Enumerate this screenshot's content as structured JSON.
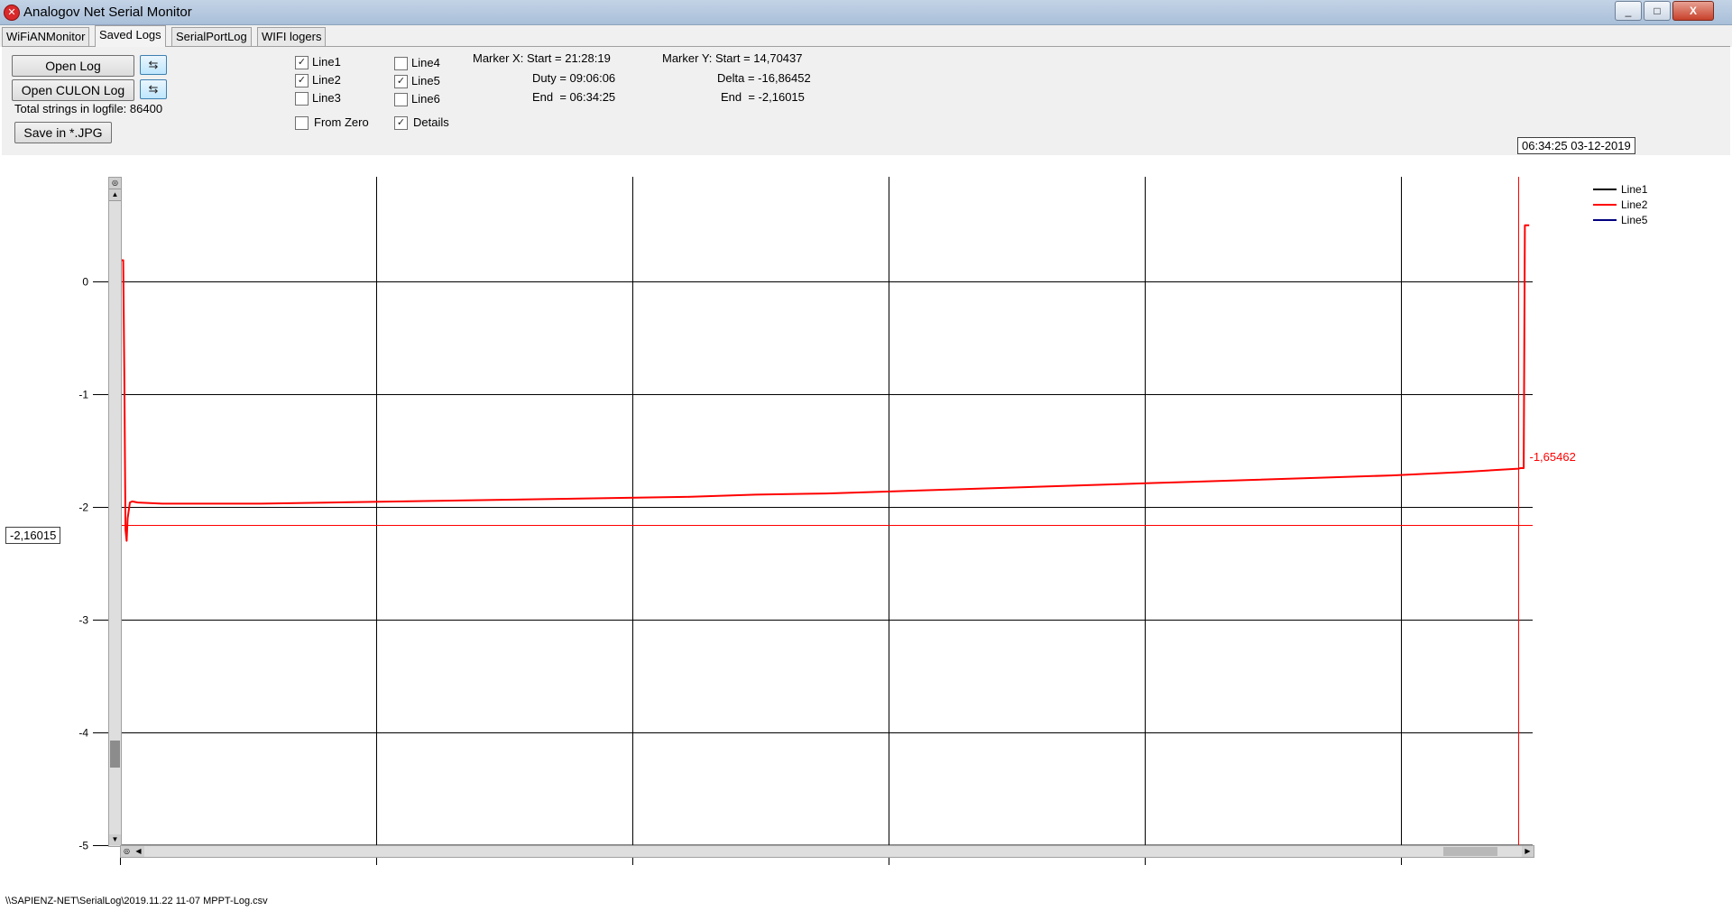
{
  "window": {
    "title": "Analogov Net Serial Monitor",
    "icon": "app-close-circle-icon",
    "minimize_glyph": "_",
    "maximize_glyph": "□",
    "close_glyph": "X"
  },
  "tabs": [
    {
      "label": "WiFiANMonitor",
      "active": false
    },
    {
      "label": "Saved Logs",
      "active": true
    },
    {
      "label": "SerialPortLog",
      "active": false
    },
    {
      "label": "WIFI logers",
      "active": false
    }
  ],
  "controls": {
    "open_log": "Open Log",
    "open_culon_log": "Open CULON Log",
    "refresh_glyph": "⇆",
    "total_strings": "Total strings in logfile: 86400",
    "save_jpg": "Save in *.JPG"
  },
  "checkboxes": [
    {
      "label": "Line1",
      "checked": true
    },
    {
      "label": "Line2",
      "checked": true
    },
    {
      "label": "Line3",
      "checked": false
    },
    {
      "label": "Line4",
      "checked": false
    },
    {
      "label": "Line5",
      "checked": true
    },
    {
      "label": "Line6",
      "checked": false
    },
    {
      "label": "From Zero",
      "checked": false
    },
    {
      "label": "Details",
      "checked": true
    }
  ],
  "marker_x": {
    "start": "Marker X: Start = 21:28:19",
    "duty": "Duty = 09:06:06",
    "end": "End  = 06:34:25"
  },
  "marker_y": {
    "start": "Marker Y: Start = 14,70437",
    "delta": "Delta = -16,86452",
    "end": "End  = -2,16015"
  },
  "cursor_datetime": "06:34:25 03-12-2019",
  "cursor_y_value": "-2,16015",
  "status_path": "\\\\SAPIENZ-NET\\SerialLog\\2019.11.22 11-07 MPPT-Log.csv",
  "chart_data": {
    "type": "line",
    "ylim": [
      -5,
      0.93
    ],
    "yticks": [
      0,
      -1,
      -2,
      -3,
      -4,
      -5
    ],
    "ytick_labels": [
      "0",
      "-1",
      "-2",
      "-3",
      "-4",
      "-5"
    ],
    "xlim": [
      0,
      1
    ],
    "x_grid": [
      0,
      0.1814,
      0.3628,
      0.5442,
      0.7256,
      0.907
    ],
    "grid": true,
    "legend": {
      "position": "top-right",
      "entries": [
        {
          "name": "Line1",
          "color": "#000000"
        },
        {
          "name": "Line2",
          "color": "#ff0000"
        },
        {
          "name": "Line5",
          "color": "#000080"
        }
      ]
    },
    "series": [
      {
        "name": "Line2",
        "color": "#ff0000",
        "x": [
          0,
          0.0023,
          0.0031,
          0.0039,
          0.0047,
          0.0054,
          0.007,
          0.0086,
          0.0125,
          0.03,
          0.07,
          0.1,
          0.15,
          0.2,
          0.25,
          0.3,
          0.35,
          0.4,
          0.45,
          0.5,
          0.55,
          0.6,
          0.65,
          0.7,
          0.75,
          0.8,
          0.85,
          0.9,
          0.95,
          0.9898,
          0.9914,
          0.9937,
          0.9945,
          0.9976
        ],
        "y": [
          0.19,
          0.19,
          -0.9,
          -2.2,
          -2.3,
          -2.1,
          -1.96,
          -1.95,
          -1.96,
          -1.97,
          -1.97,
          -1.97,
          -1.96,
          -1.95,
          -1.94,
          -1.93,
          -1.92,
          -1.91,
          -1.89,
          -1.88,
          -1.86,
          -1.84,
          -1.82,
          -1.8,
          -1.78,
          -1.76,
          -1.74,
          -1.72,
          -1.69,
          -1.66,
          -1.65462,
          -1.65462,
          0.5,
          0.5
        ]
      },
      {
        "name": "Line1",
        "color": "#000000",
        "x": [],
        "y": []
      },
      {
        "name": "Line5",
        "color": "#000080",
        "x": [],
        "y": []
      }
    ],
    "markers": {
      "y_line_value": -2.16015,
      "x_line_position": 0.9898,
      "y_end_label": "-1,65462"
    }
  }
}
